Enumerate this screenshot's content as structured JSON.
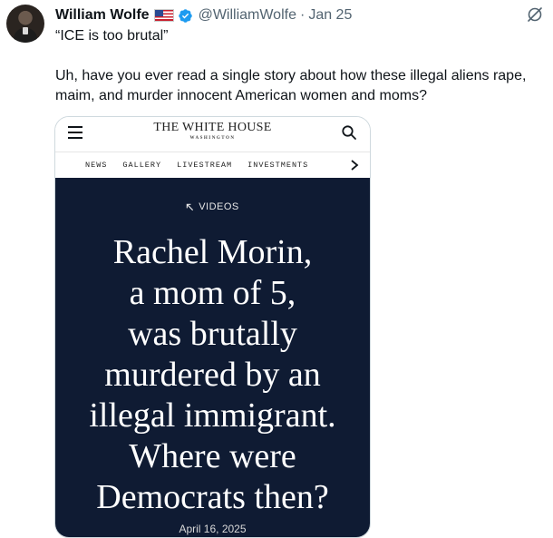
{
  "tweet": {
    "author_name": "William Wolfe",
    "handle": "@WilliamWolfe",
    "separator": "·",
    "date": "Jan 25",
    "flag_icon": "us-flag-icon",
    "verified_icon": "verified-badge-icon",
    "grok_icon": "grok-icon",
    "quote_text": "“ICE is too brutal”",
    "body_text": "Uh, have you ever read a single story about how these illegal aliens rape, maim, and murder innocent American women and moms?"
  },
  "card": {
    "site_title": "THE WHITE HOUSE",
    "site_subtitle": "WASHINGTON",
    "nav_items": [
      "NEWS",
      "GALLERY",
      "LIVESTREAM",
      "INVESTMENTS"
    ],
    "tag": "VIDEOS",
    "headline_lines": [
      "Rachel Morin,",
      "a mom of 5,",
      "was brutally",
      "murdered by an",
      "illegal immigrant.",
      "Where were",
      "Democrats then?"
    ],
    "date": "April 16, 2025",
    "colors": {
      "hero_bg": "#0f1b33",
      "verified_blue": "#1d9bf0"
    }
  }
}
